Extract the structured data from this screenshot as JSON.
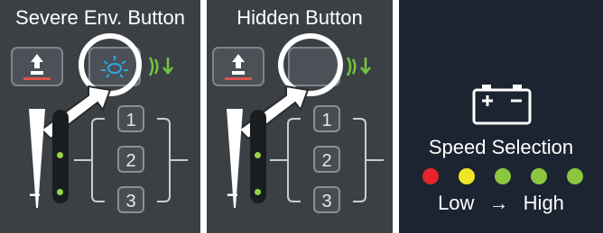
{
  "panels": {
    "severe": {
      "title": "Severe Env. Button",
      "segments": [
        "1",
        "2",
        "3"
      ]
    },
    "hidden": {
      "title": "Hidden Button",
      "segments": [
        "1",
        "2",
        "3"
      ]
    }
  },
  "speed": {
    "title": "Speed Selection",
    "low": "Low",
    "arrow": "→",
    "high": "High",
    "leds": [
      "#e5242b",
      "#f0e528",
      "#8cc63f",
      "#8cc63f",
      "#8cc63f"
    ]
  },
  "icons": {
    "lift": "lift-icon",
    "severe_env": "severe-environment-icon",
    "plus": "+",
    "minus": "−",
    "eye": "eye-arrow-icon"
  },
  "colors": {
    "panel_bg": "#3b4045",
    "led_green": "#97d34a",
    "accent_blue": "#2ea6e8"
  }
}
